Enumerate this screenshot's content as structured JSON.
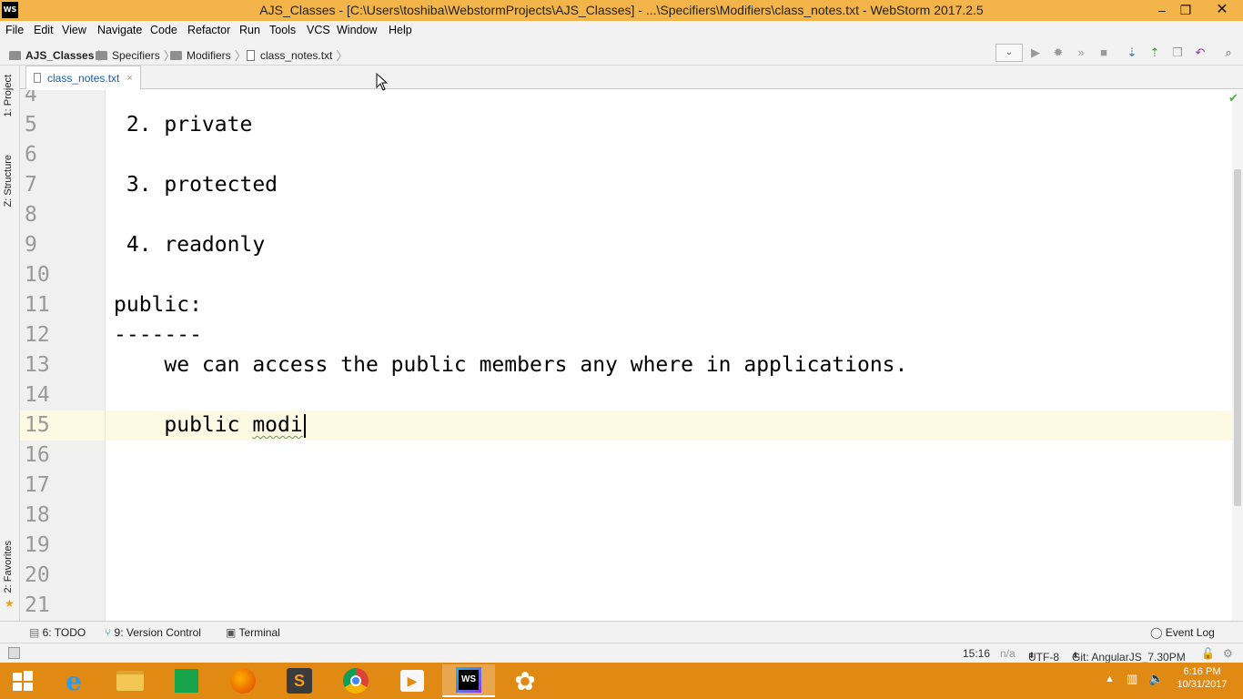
{
  "window": {
    "title": "AJS_Classes - [C:\\Users\\toshiba\\WebstormProjects\\AJS_Classes] - ...\\Specifiers\\Modifiers\\class_notes.txt - WebStorm 2017.2.5",
    "logo_text": "WS",
    "minimize": "–",
    "restore": "❐",
    "close": "✕"
  },
  "menu": [
    "File",
    "Edit",
    "View",
    "Navigate",
    "Code",
    "Refactor",
    "Run",
    "Tools",
    "VCS",
    "Window",
    "Help"
  ],
  "breadcrumb": [
    "AJS_Classes",
    "Specifiers",
    "Modifiers",
    "class_notes.txt"
  ],
  "toolbar_icons": [
    "run-config-dropdown",
    "run-icon",
    "debug-icon",
    "coverage-icon",
    "stop-icon",
    "vcs-update-icon",
    "vcs-commit-icon",
    "vcs-compare-icon",
    "revert-icon",
    "search-icon"
  ],
  "tab": {
    "label": "class_notes.txt",
    "close": "×"
  },
  "side_tabs": {
    "project": "1: Project",
    "structure": "Z: Structure",
    "favorites": "2: Favorites"
  },
  "lines": [
    {
      "num": "4",
      "text": ""
    },
    {
      "num": "5",
      "text": " 2. private"
    },
    {
      "num": "6",
      "text": ""
    },
    {
      "num": "7",
      "text": " 3. protected"
    },
    {
      "num": "8",
      "text": ""
    },
    {
      "num": "9",
      "text": " 4. readonly"
    },
    {
      "num": "10",
      "text": ""
    },
    {
      "num": "11",
      "text": "public:"
    },
    {
      "num": "12",
      "text": "-------"
    },
    {
      "num": "13",
      "text": "    we can access the public members any where in applications."
    },
    {
      "num": "14",
      "text": ""
    },
    {
      "num": "15",
      "text_prefix": "    public ",
      "text_squiggle": "modi"
    },
    {
      "num": "16",
      "text": ""
    },
    {
      "num": "17",
      "text": ""
    },
    {
      "num": "18",
      "text": ""
    },
    {
      "num": "19",
      "text": ""
    },
    {
      "num": "20",
      "text": ""
    },
    {
      "num": "21",
      "text": ""
    }
  ],
  "tool_windows": {
    "todo": "6: TODO",
    "vcs": "9: Version Control",
    "terminal": "Terminal",
    "event_log": "Event Log"
  },
  "status": {
    "position": "15:16",
    "na": "n/a",
    "encoding": "UTF-8",
    "git": "Git: AngularJS_7.30PM"
  },
  "clock": {
    "time": "6:16 PM",
    "date": "10/31/2017"
  },
  "colors": {
    "titlebar": "#f3b54a",
    "taskbar": "#e08a14",
    "tab_text": "#1a5aa8"
  }
}
